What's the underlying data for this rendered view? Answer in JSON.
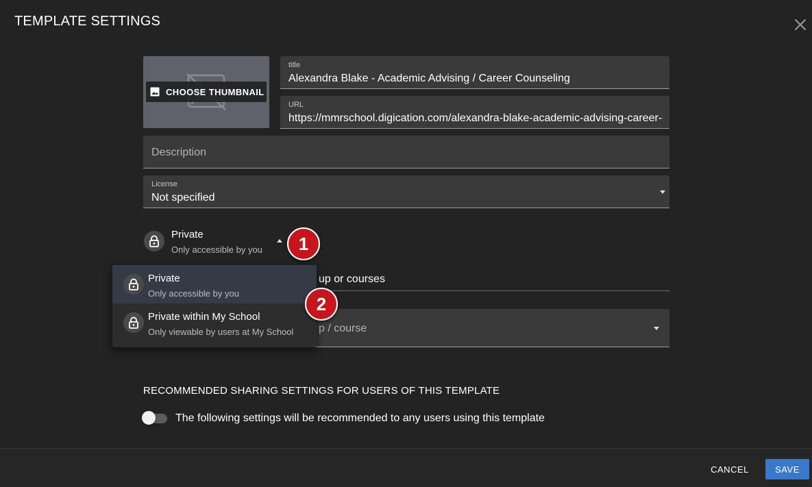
{
  "dialog": {
    "title": "TEMPLATE SETTINGS"
  },
  "thumbnail": {
    "button_label": "CHOOSE THUMBNAIL"
  },
  "fields": {
    "title": {
      "label": "title",
      "value": "Alexandra Blake - Academic Advising / Career Counseling"
    },
    "url": {
      "label": "URL",
      "value": "https://mmrschool.digication.com/alexandra-blake-academic-advising-career-counseling"
    },
    "description": {
      "placeholder": "Description"
    },
    "license": {
      "label": "License",
      "value": "Not specified"
    }
  },
  "privacy": {
    "selected_title": "Private",
    "selected_subtitle": "Only accessible by you",
    "options": [
      {
        "title": "Private",
        "subtitle": "Only accessible by you"
      },
      {
        "title": "Private within My School",
        "subtitle": "Only viewable by users at My School"
      }
    ]
  },
  "behind": {
    "text": "up or courses",
    "select_placeholder": "p / course"
  },
  "badges": [
    "1",
    "2"
  ],
  "sharing": {
    "heading": "RECOMMENDED SHARING SETTINGS FOR USERS OF THIS TEMPLATE",
    "toggle_label": "The following settings will be recommended to any users using this template"
  },
  "footer": {
    "cancel_label": "CANCEL",
    "save_label": "SAVE"
  },
  "colors": {
    "background": "#232323",
    "field": "#3a3a3a",
    "badge": "#c4161c",
    "save": "#3a78c9"
  },
  "icons": [
    "close-icon",
    "image-icon",
    "image-placeholder-icon",
    "lock-icon",
    "caret-down-icon",
    "caret-up-icon"
  ]
}
